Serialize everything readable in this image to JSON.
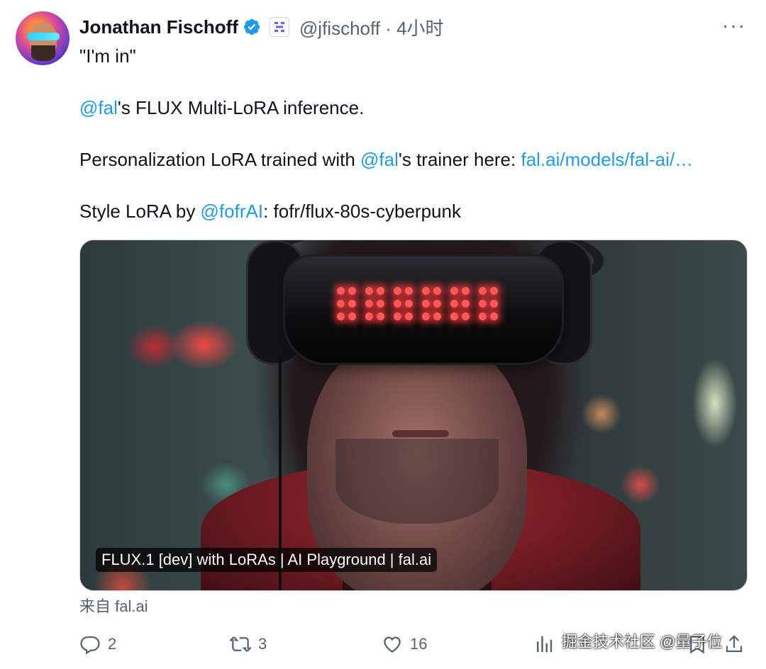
{
  "author": {
    "name": "Jonathan Fischoff",
    "handle": "@jfischoff",
    "time_sep": " · ",
    "time": "4小时"
  },
  "more_label": "···",
  "tweet": {
    "line1": "\"I'm in\"",
    "line2_link": "@fal",
    "line2_rest": "'s FLUX Multi-LoRA inference.",
    "line3_pre": "Personalization LoRA trained with ",
    "line3_link": "@fal",
    "line3_mid": "'s trainer here: ",
    "line3_url": "fal.ai/models/fal-ai/…",
    "line4_pre": "Style LoRA by ",
    "line4_link": "@fofrAI",
    "line4_rest": ": fofr/flux-80s-cyberpunk"
  },
  "media": {
    "caption": "FLUX.1 [dev] with LoRAs | AI Playground | fal.ai"
  },
  "source": "来自 fal.ai",
  "actions": {
    "replies": "2",
    "retweets": "3",
    "likes": "16"
  },
  "watermark": "掘金技术社区 @量子位",
  "colors": {
    "link": "#1d9bf0",
    "muted": "#536471",
    "text": "#0f1419"
  }
}
